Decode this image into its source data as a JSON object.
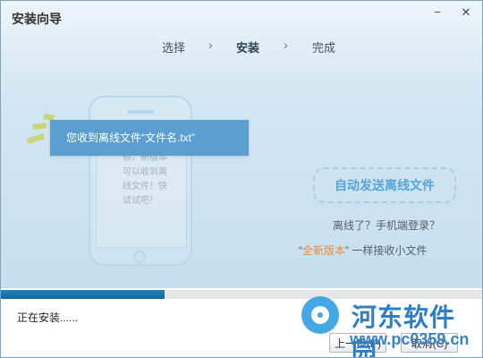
{
  "window": {
    "title": "安装向导"
  },
  "controls": {
    "minimize_icon": "−",
    "close_icon": "✕"
  },
  "steps": [
    {
      "label": "选择"
    },
    {
      "label": "安装"
    },
    {
      "label": "完成"
    }
  ],
  "step_separator": "›",
  "hero": {
    "banner_text": "您收到离线文件“文件名.txt”",
    "phone_message": "我正在休假，新版本可以收到离线文件！快试试吧！",
    "offline_button": "自动发送离线文件",
    "offline_question": "离线了？手机端登录？",
    "new_version_prefix": "“",
    "new_version_hi": "全新版本",
    "new_version_suffix": "” 一样接收小文件"
  },
  "progress": {
    "value_pct": 34
  },
  "status": {
    "text": "正在安装......"
  },
  "buttons": {
    "prev": "上一步(P)",
    "cancel": "取消(C)"
  },
  "watermark": {
    "text": "河东软件园",
    "url": "www.pc0359.cn"
  },
  "colors": {
    "accent": "#5b9fd1",
    "progress": "#1f84bd",
    "highlight": "#f08b33"
  }
}
